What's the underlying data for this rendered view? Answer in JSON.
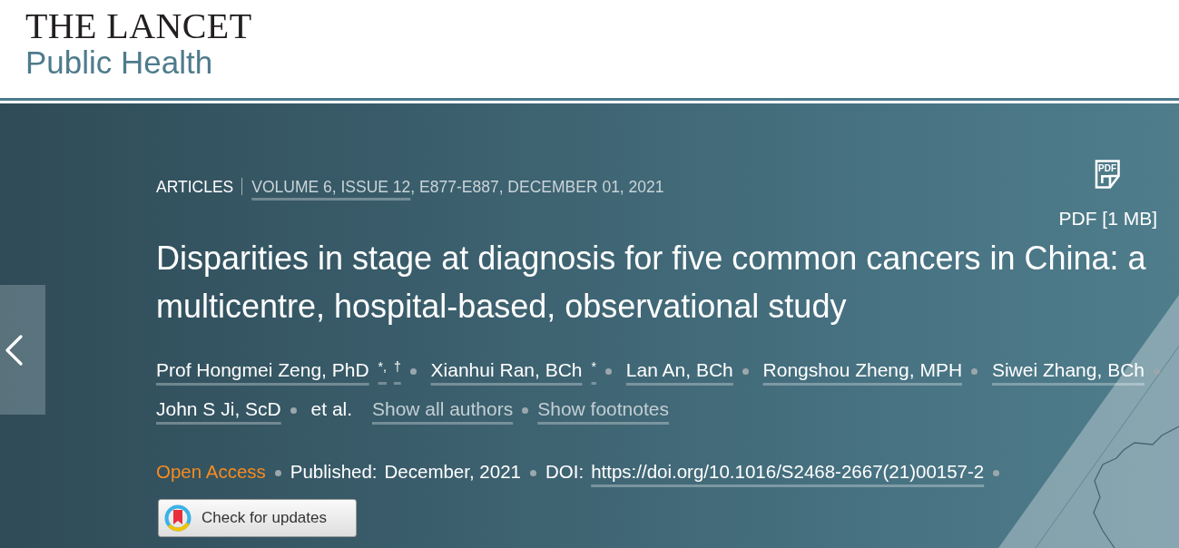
{
  "header": {
    "journal": "THE LANCET",
    "subtitle": "Public Health"
  },
  "article": {
    "type": "ARTICLES",
    "issue_link": "VOLUME 6, ISSUE 12",
    "pages_date": ", E877-E887, DECEMBER 01, 2021",
    "pdf": {
      "icon_text": "PDF",
      "label": "PDF [1 MB]"
    },
    "title": "Disparities in stage at diagnosis for five common cancers in China: a multicentre, hospital-based, observational study",
    "authors": [
      {
        "name": "Prof Hongmei Zeng, PhD",
        "footnotes": [
          "*,",
          "†"
        ]
      },
      {
        "name": "Xianhui Ran, BCh",
        "footnotes": [
          "*"
        ]
      },
      {
        "name": "Lan An, BCh"
      },
      {
        "name": "Rongshou Zheng, MPH"
      },
      {
        "name": "Siwei Zhang, BCh"
      },
      {
        "name": "John S Ji, ScD"
      }
    ],
    "et_al": "et al.",
    "show_all_authors": "Show all authors",
    "show_footnotes": "Show footnotes",
    "meta": [
      {
        "kind": "access",
        "text": "Open Access"
      },
      {
        "kind": "date",
        "label": "Published:",
        "value": "December, 2021"
      },
      {
        "kind": "doi",
        "label": "DOI:",
        "value": "https://doi.org/10.1016/S2468-2667(21)00157-2"
      }
    ],
    "check_updates": "Check for updates"
  }
}
